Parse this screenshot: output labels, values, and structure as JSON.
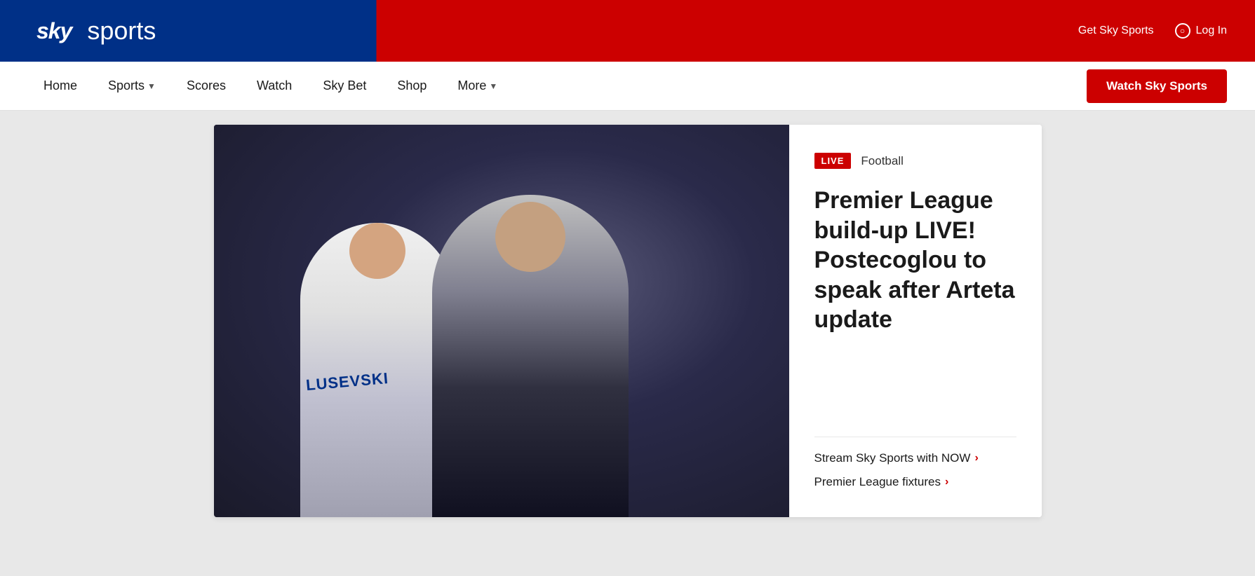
{
  "header": {
    "logo_sky": "sky",
    "logo_sports": "sports",
    "get_sky_sports_label": "Get Sky Sports",
    "login_label": "Log In"
  },
  "nav": {
    "home_label": "Home",
    "sports_label": "Sports",
    "scores_label": "Scores",
    "watch_label": "Watch",
    "skybet_label": "Sky Bet",
    "shop_label": "Shop",
    "more_label": "More",
    "watch_sky_sports_label": "Watch Sky Sports"
  },
  "article": {
    "live_badge": "LIVE",
    "category": "Football",
    "headline": "Premier League build-up LIVE! Postecoglou to speak after Arteta update",
    "jersey_text": "LUSEVSKI",
    "stream_label": "Stream Sky Sports with NOW",
    "fixtures_label": "Premier League fixtures"
  },
  "colors": {
    "red": "#cc0000",
    "dark_blue": "#003087",
    "white": "#ffffff"
  }
}
